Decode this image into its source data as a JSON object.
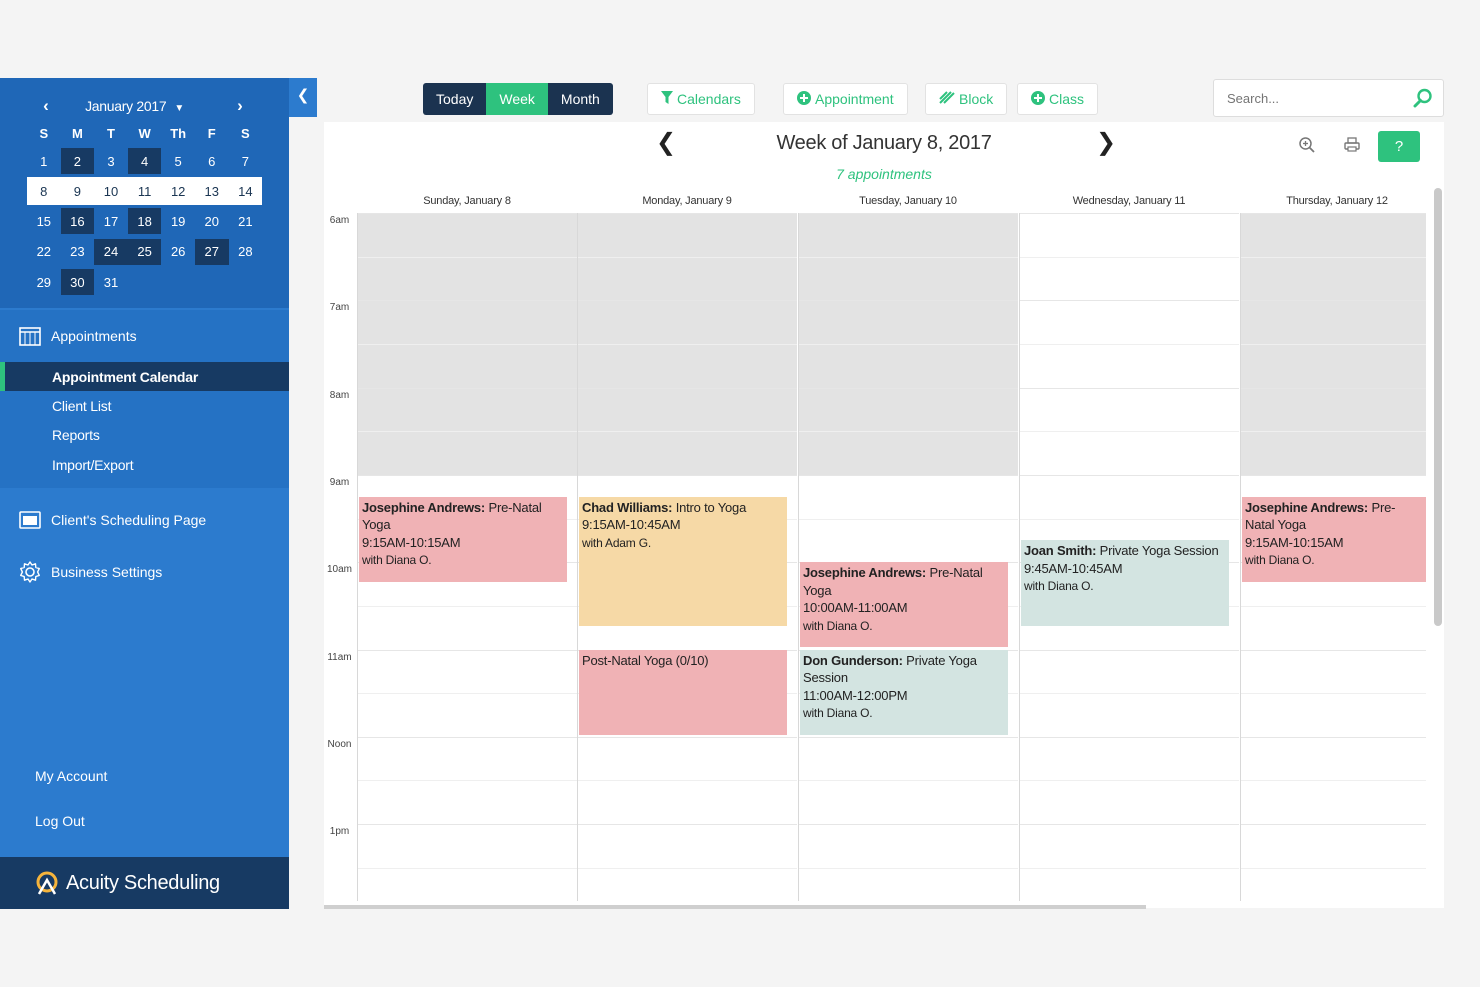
{
  "sidebar": {
    "mini_calendar": {
      "month_label": "January 2017",
      "prev_icon": "‹",
      "next_icon": "›",
      "day_headers": [
        "S",
        "M",
        "T",
        "W",
        "Th",
        "F",
        "S"
      ],
      "weeks": [
        [
          "1",
          "2",
          "3",
          "4",
          "5",
          "6",
          "7"
        ],
        [
          "8",
          "9",
          "10",
          "11",
          "12",
          "13",
          "14"
        ],
        [
          "15",
          "16",
          "17",
          "18",
          "19",
          "20",
          "21"
        ],
        [
          "22",
          "23",
          "24",
          "25",
          "26",
          "27",
          "28"
        ],
        [
          "29",
          "30",
          "31",
          "",
          "",
          "",
          ""
        ]
      ],
      "selected_week_index": 1
    },
    "appointments_label": "Appointments",
    "sub_items": [
      "Appointment Calendar",
      "Client List",
      "Reports",
      "Import/Export"
    ],
    "clients_page_label": "Client's Scheduling Page",
    "business_settings_label": "Business Settings",
    "my_account_label": "My Account",
    "logout_label": "Log Out",
    "brand": "Acuity Scheduling"
  },
  "toolbar": {
    "views": [
      "Today",
      "Week",
      "Month"
    ],
    "active_view": "Week",
    "calendars_label": "Calendars",
    "appointment_label": "Appointment",
    "block_label": "Block",
    "class_label": "Class",
    "search_placeholder": "Search..."
  },
  "calendar": {
    "title": "Week of January 8, 2017",
    "subtitle": "7 appointments",
    "help_label": "?",
    "days": [
      "Sunday, January 8",
      "Monday, January 9",
      "Tuesday, January 10",
      "Wednesday, January 11",
      "Thursday, January 12"
    ],
    "time_labels": [
      "6am",
      "7am",
      "8am",
      "9am",
      "10am",
      "11am",
      "Noon",
      "1pm"
    ],
    "appointments": [
      {
        "day": 0,
        "client": "Josephine Andrews:",
        "service": "Pre-Natal Yoga",
        "time": "9:15AM-10:15AM",
        "with": "with Diana O.",
        "color": "pink"
      },
      {
        "day": 1,
        "client": "Chad Williams:",
        "service": "Intro to Yoga",
        "time": "9:15AM-10:45AM",
        "with": "with Adam G.",
        "color": "peach"
      },
      {
        "day": 1,
        "client": "",
        "service": "Post-Natal Yoga (0/10)",
        "time": "",
        "with": "",
        "color": "pink"
      },
      {
        "day": 2,
        "client": "Josephine Andrews:",
        "service": "Pre-Natal Yoga",
        "time": "10:00AM-11:00AM",
        "with": "with Diana O.",
        "color": "pink"
      },
      {
        "day": 2,
        "client": "Don Gunderson:",
        "service": "Private Yoga Session",
        "time": "11:00AM-12:00PM",
        "with": "with Diana O.",
        "color": "mint"
      },
      {
        "day": 3,
        "client": "Joan Smith:",
        "service": "Private Yoga Session",
        "time": "9:45AM-10:45AM",
        "with": "with Diana O.",
        "color": "mint"
      },
      {
        "day": 4,
        "client": "Josephine Andrews:",
        "service": "Pre-Natal Yoga",
        "time": "9:15AM-10:15AM",
        "with": "with Diana O.",
        "color": "pink"
      }
    ]
  },
  "colors": {
    "accent": "#2ec27e",
    "sidebar": "#2c7bce",
    "sidebar_dark": "#173a63",
    "pink": "#f0b2b5",
    "peach": "#f6d9a6",
    "mint": "#d3e4e1"
  },
  "icons": {
    "appointments": "calendar-grid-icon",
    "clients_page": "browser-window-icon",
    "business_settings": "gear-icon",
    "calendars": "filter-icon",
    "appointment": "plus-circle-icon",
    "block": "block-stripes-icon",
    "class": "plus-circle-icon",
    "search": "search-icon",
    "zoom": "zoom-icon",
    "print": "print-icon",
    "collapse": "chevron-left-icon"
  }
}
